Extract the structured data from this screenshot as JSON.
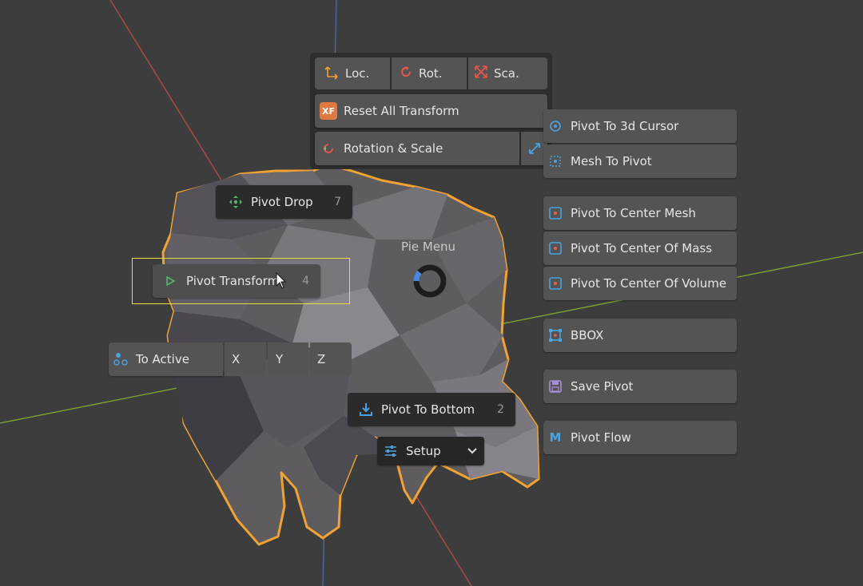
{
  "pie": {
    "title": "Pie Menu"
  },
  "transform_panel": {
    "loc_label": "Loc.",
    "rot_label": "Rot.",
    "sca_label": "Sca.",
    "reset_all_label": "Reset All Transform",
    "reset_icon_text": "XF",
    "rotation_scale_label": "Rotation & Scale"
  },
  "pivot_drop": {
    "label": "Pivot Drop",
    "number": "7"
  },
  "pivot_transform": {
    "label": "Pivot Transform",
    "number": "4"
  },
  "to_active": {
    "label": "To Active",
    "x": "X",
    "y": "Y",
    "z": "Z"
  },
  "pivot_bottom": {
    "label": "Pivot To Bottom",
    "number": "2"
  },
  "setup": {
    "label": "Setup"
  },
  "right_menu": {
    "cursor": "Pivot To 3d Cursor",
    "mesh_to_pivot": "Mesh To Pivot",
    "center_mesh": "Pivot To Center Mesh",
    "center_mass": "Pivot To Center Of Mass",
    "center_volume": "Pivot To Center Of Volume",
    "bbox": "BBOX",
    "save_pivot": "Save Pivot",
    "pivot_flow": "Pivot Flow",
    "pivot_flow_icon_text": "M"
  },
  "colors": {
    "background": "#3c3c3c",
    "button": "#545454",
    "accent_orange": "#f0a232",
    "accent_blue": "#4aa3df",
    "axis_red": "#b04545",
    "axis_green": "#7ea234"
  }
}
